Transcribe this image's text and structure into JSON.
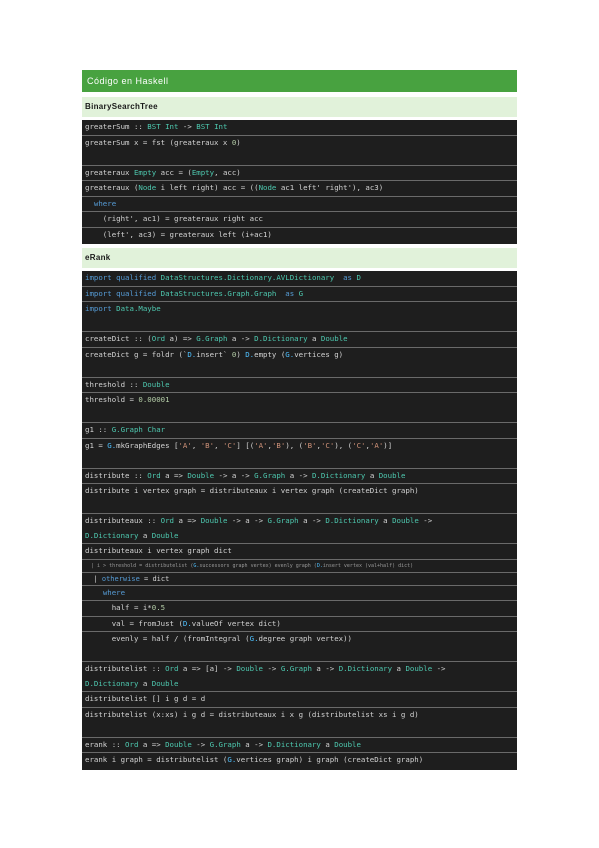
{
  "title": "Código en Haskell",
  "sections": [
    {
      "header": "BinarySearchTree",
      "lines": [
        "greaterSum :: BST Int -> BST Int",
        "greaterSum x = fst (greateraux x 0)",
        "",
        "greateraux Empty acc = (Empty, acc)",
        "greateraux (Node i left right) acc = ((Node ac1 left' right'), ac3)",
        "  where",
        "    (right', ac1) = greateraux right acc",
        "    (left', ac3) = greateraux left (i+ac1)"
      ]
    },
    {
      "header": "eRank",
      "lines": [
        "import qualified DataStructures.Dictionary.AVLDictionary  as D",
        "import qualified DataStructures.Graph.Graph  as G",
        "import Data.Maybe",
        "",
        "createDict :: (Ord a) => G.Graph a -> D.Dictionary a Double",
        "createDict g = foldr (`D.insert` 0) D.empty (G.vertices g)",
        "",
        "threshold :: Double",
        "threshold = 0.00001",
        "",
        "g1 :: G.Graph Char",
        "g1 = G.mkGraphEdges ['A', 'B', 'C'] [('A','B'), ('B','C'), ('C','A')]",
        "",
        "distribute :: Ord a => Double -> a -> G.Graph a -> D.Dictionary a Double",
        "distribute i vertex graph = distributeaux i vertex graph (createDict graph)",
        "",
        "distributeaux :: Ord a => Double -> a -> G.Graph a -> D.Dictionary a Double ->",
        "D.Dictionary a Double",
        "distributeaux i vertex graph dict",
        "  | i > threshold = distributelist (G.successors graph vertex) evenly graph (D.insert vertex (val+half) dict)",
        "  | otherwise = dict",
        "    where",
        "      half = i*0.5",
        "      val = fromJust (D.valueOf vertex dict)",
        "      evenly = half / (fromIntegral (G.degree graph vertex))",
        "",
        "distributelist :: Ord a => [a] -> Double -> G.Graph a -> D.Dictionary a Double ->",
        "D.Dictionary a Double",
        "distributelist [] i g d = d",
        "distributelist (x:xs) i g d = distributeaux i x g (distributelist xs i g d)",
        "",
        "erank :: Ord a => Double -> G.Graph a -> D.Dictionary a Double",
        "erank i graph = distributelist (G.vertices graph) i graph (createDict graph)"
      ]
    }
  ]
}
